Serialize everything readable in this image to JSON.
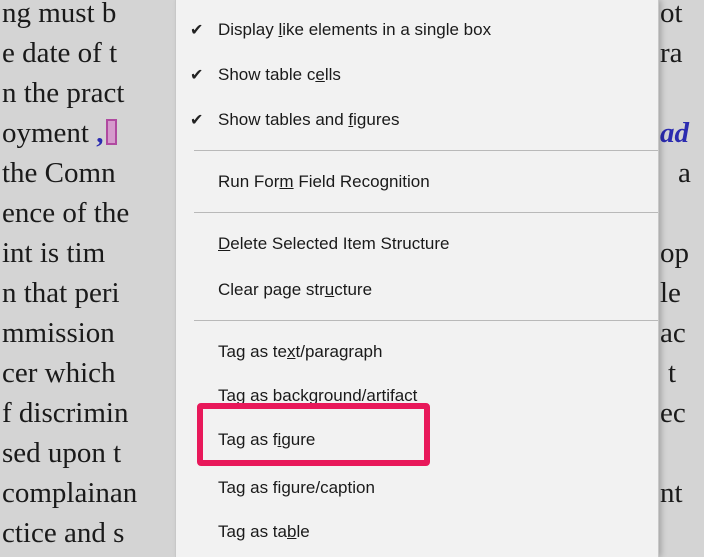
{
  "document": {
    "left_lines": [
      "ng must b",
      "e date of t",
      "n the pract",
      "oyment ,",
      "the Comn",
      "ence of the",
      "int is tim",
      "n that peri",
      "mmission",
      "cer which",
      "f discrimin",
      "sed upon t",
      "complainan",
      "ctice and s"
    ],
    "right_lines": [
      "ot",
      "ra",
      "",
      "ad",
      "a",
      "",
      "op",
      "le",
      "ac",
      "t",
      "ec",
      "",
      "nt",
      ""
    ],
    "accent_color": "#2b2bb0"
  },
  "menu": {
    "items": [
      {
        "pre": "Display ",
        "key": "l",
        "post": "ike elements in a single box",
        "checked": true,
        "check_glyph": "✔"
      },
      {
        "pre": "Show table c",
        "key": "e",
        "post": "lls",
        "checked": true,
        "check_glyph": "✔"
      },
      {
        "pre": "Show tables and ",
        "key": "f",
        "post": "igures",
        "checked": true,
        "check_glyph": "✔"
      },
      {
        "pre": "Run For",
        "key": "m",
        "post": " Field Recognition",
        "checked": false,
        "check_glyph": ""
      },
      {
        "pre": "",
        "key": "D",
        "post": "elete Selected Item Structure",
        "checked": false,
        "check_glyph": ""
      },
      {
        "pre": "Clear page str",
        "key": "u",
        "post": "cture",
        "checked": false,
        "check_glyph": ""
      },
      {
        "pre": "Tag as te",
        "key": "x",
        "post": "t/paragraph",
        "checked": false,
        "check_glyph": ""
      },
      {
        "pre": "Tag as background/artifact",
        "key": "",
        "post": "",
        "checked": false,
        "check_glyph": ""
      },
      {
        "pre": "Tag as f",
        "key": "i",
        "post": "gure",
        "checked": false,
        "check_glyph": ""
      },
      {
        "pre": "Tag as fi",
        "key": "g",
        "post": "ure/caption",
        "checked": false,
        "check_glyph": ""
      },
      {
        "pre": "Tag as ta",
        "key": "b",
        "post": "le",
        "checked": false,
        "check_glyph": ""
      }
    ],
    "highlight_color": "#e8185a"
  }
}
